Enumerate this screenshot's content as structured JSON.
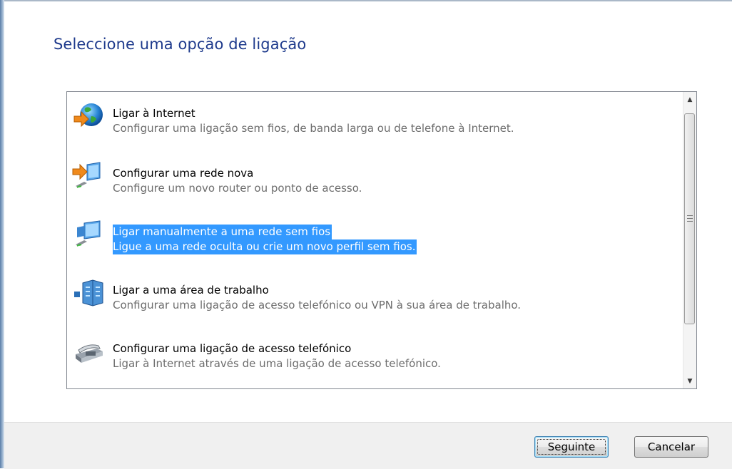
{
  "heading": "Seleccione uma opção de ligação",
  "options": [
    {
      "title": "Ligar à Internet",
      "description": "Configurar uma ligação sem fios, de banda larga ou de telefone à Internet.",
      "icon": "globe-internet-icon",
      "selected": false
    },
    {
      "title": "Configurar uma rede nova",
      "description": "Configure um novo router ou ponto de acesso.",
      "icon": "new-network-icon",
      "selected": false
    },
    {
      "title": "Ligar manualmente a uma rede sem fios",
      "description": "Ligue a uma rede oculta ou crie um novo perfil sem fios.",
      "icon": "wireless-network-icon",
      "selected": true
    },
    {
      "title": "Ligar a uma área de trabalho",
      "description": "Configurar uma ligação de acesso telefónico ou VPN à sua área de trabalho.",
      "icon": "workplace-building-icon",
      "selected": false
    },
    {
      "title": "Configurar uma ligação de acesso telefónico",
      "description": "Ligar à Internet através de uma ligação de acesso telefónico.",
      "icon": "dialup-phone-icon",
      "selected": false
    }
  ],
  "buttons": {
    "next": "Seguinte",
    "cancel": "Cancelar"
  },
  "colors": {
    "heading": "#1e3a8c",
    "selection": "#3399ff",
    "description": "#6d6d6d"
  }
}
